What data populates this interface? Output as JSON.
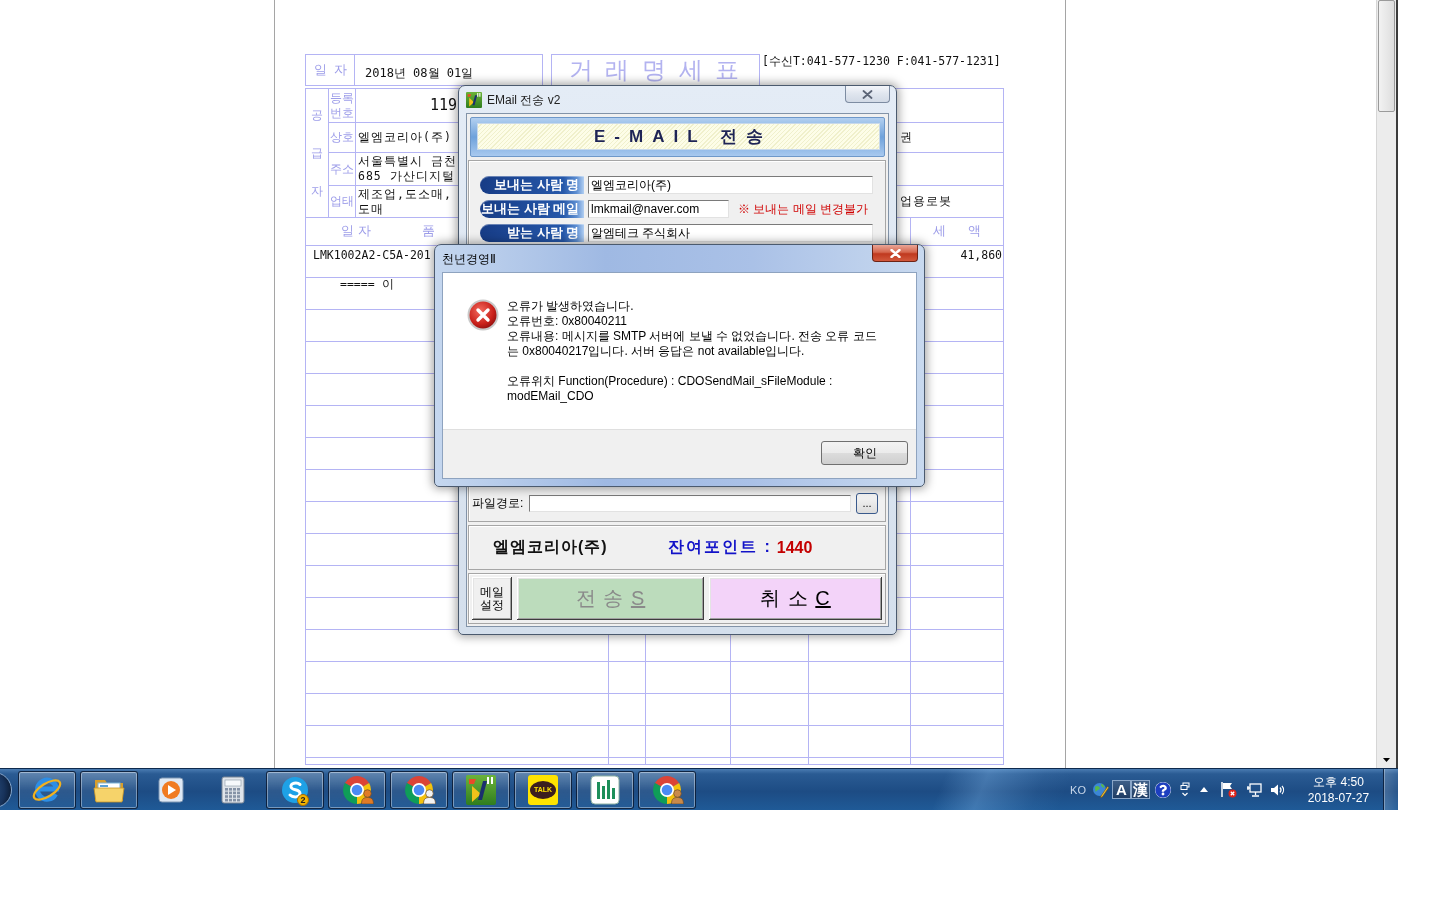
{
  "document": {
    "date_label": "일자",
    "date": "2018년 08월 01일",
    "title": "거 래 명 세 표",
    "contact": "[수신T:041-577-1230 F:041-577-1231]",
    "supplier": {
      "section_label": "공급자",
      "rows": [
        {
          "kind": "reg_no",
          "label": "등록번호",
          "lines": [
            "119"
          ]
        },
        {
          "kind": "text",
          "label": "상호",
          "lines": [
            "엘엠코리아(주)"
          ],
          "right": "권"
        },
        {
          "kind": "text",
          "label": "주소",
          "lines": [
            "서울특별시 금천",
            "685 가산디지털"
          ]
        },
        {
          "kind": "text",
          "label": "업태",
          "lines": [
            "제조업,도소매,",
            "도매"
          ],
          "right": "업용로봇"
        }
      ]
    },
    "items": {
      "header": {
        "date": "일자",
        "item": "품",
        "tax": "세 액"
      },
      "rows": [
        {
          "kind": "item",
          "text": "LMK1002A2-C5A-201",
          "tax": "41,860"
        },
        {
          "kind": "note",
          "text": "===== 이"
        }
      ]
    }
  },
  "email_window": {
    "title": "EMail 전송 v2",
    "banner": "E-MAIL 전송",
    "fields": [
      {
        "label": "보내는 사람 명",
        "value": "엘엠코리아(주)"
      },
      {
        "label": "보내는 사람 메일",
        "value": "lmkmail@naver.com",
        "note": "※ 보내는 메일 변경불가"
      },
      {
        "label": "받는 사람 명",
        "value": "알엠테크 주식회사"
      }
    ],
    "file_path": {
      "label": "파일경로:",
      "browse": "..."
    },
    "info": {
      "company": "엘엠코리아(주)",
      "points_label": "잔여포인트 :",
      "points": "1440"
    },
    "buttons": [
      {
        "kind": "settings",
        "label": "메일 설정",
        "disabled": false
      },
      {
        "kind": "send",
        "label": "전 송",
        "access_key": "S",
        "disabled": true
      },
      {
        "kind": "cancel",
        "label": "취 소",
        "access_key": "C",
        "disabled": false
      }
    ]
  },
  "error_dialog": {
    "title": "천년경영Ⅱ",
    "message_blocks": [
      [
        "오류가 발생하였습니다.",
        "오류번호: 0x80040211",
        "오류내용: 메시지를 SMTP 서버에 보낼 수 없었습니다. 전송 오류 코드는 0x80040217입니다. 서버 응답은 not available입니다."
      ],
      [
        "오류위치 Function(Procedure) : CDOSendMail_sFileModule : modEMail_CDO"
      ]
    ],
    "ok_button": "확인"
  },
  "taskbar": {
    "apps": [
      {
        "kind": "e_logo",
        "running": true
      },
      {
        "kind": "folder",
        "running": true
      },
      {
        "kind": "player",
        "running": false
      },
      {
        "kind": "calculator",
        "running": false
      },
      {
        "kind": "s_logo",
        "running": true,
        "badge": "2"
      },
      {
        "kind": "browser",
        "running": true,
        "color": "#e07b28"
      },
      {
        "kind": "browser",
        "running": true,
        "color": "#f2f2f2"
      },
      {
        "kind": "tile",
        "running": true
      },
      {
        "kind": "talk",
        "running": true,
        "logo_text": "TALK"
      },
      {
        "kind": "bars",
        "running": true
      },
      {
        "kind": "browser",
        "running": true,
        "color": "#c98a4b"
      }
    ],
    "tray": {
      "language": "KO",
      "ime_modes": [
        "A",
        "漢"
      ],
      "time": "오후 4:50",
      "date": "2018-07-27"
    }
  }
}
